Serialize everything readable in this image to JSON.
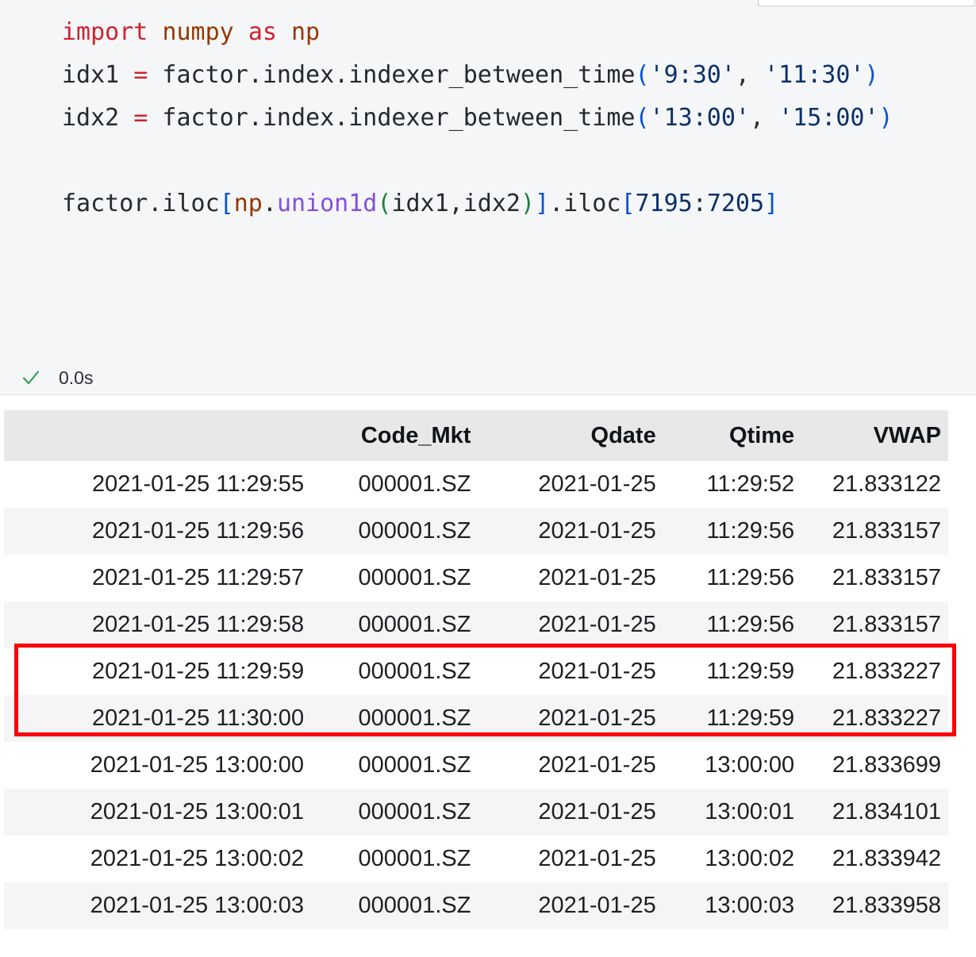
{
  "notebook": {
    "cell": {
      "language": "python",
      "code_lines": [
        [
          {
            "t": "import",
            "c": "kw"
          },
          {
            "t": " ",
            "c": "plain"
          },
          {
            "t": "numpy",
            "c": "module"
          },
          {
            "t": " ",
            "c": "plain"
          },
          {
            "t": "as",
            "c": "kw"
          },
          {
            "t": " ",
            "c": "plain"
          },
          {
            "t": "np",
            "c": "module"
          }
        ],
        [
          {
            "t": "idx1 ",
            "c": "plain"
          },
          {
            "t": "=",
            "c": "op"
          },
          {
            "t": " factor.index.indexer_between_time",
            "c": "plain"
          },
          {
            "t": "(",
            "c": "brkblue"
          },
          {
            "t": "'9:30'",
            "c": "str"
          },
          {
            "t": ",",
            "c": "punc"
          },
          {
            "t": " ",
            "c": "plain"
          },
          {
            "t": "'11:30'",
            "c": "str"
          },
          {
            "t": ")",
            "c": "brkblue"
          }
        ],
        [
          {
            "t": "idx2 ",
            "c": "plain"
          },
          {
            "t": "=",
            "c": "op"
          },
          {
            "t": " factor.index.indexer_between_time",
            "c": "plain"
          },
          {
            "t": "(",
            "c": "brkblue"
          },
          {
            "t": "'13:00'",
            "c": "str"
          },
          {
            "t": ",",
            "c": "punc"
          },
          {
            "t": " ",
            "c": "plain"
          },
          {
            "t": "'15:00'",
            "c": "str"
          },
          {
            "t": ")",
            "c": "brkblue"
          }
        ],
        [],
        [
          {
            "t": "factor.iloc",
            "c": "plain"
          },
          {
            "t": "[",
            "c": "brkblue"
          },
          {
            "t": "np",
            "c": "module"
          },
          {
            "t": ".",
            "c": "punc"
          },
          {
            "t": "union1d",
            "c": "func"
          },
          {
            "t": "(",
            "c": "paren"
          },
          {
            "t": "idx1,idx2",
            "c": "plain"
          },
          {
            "t": ")",
            "c": "paren"
          },
          {
            "t": "]",
            "c": "brkblue"
          },
          {
            "t": ".iloc",
            "c": "plain"
          },
          {
            "t": "[",
            "c": "brkblue"
          },
          {
            "t": "7195",
            "c": "num"
          },
          {
            "t": ":",
            "c": "punc"
          },
          {
            "t": "7205",
            "c": "num"
          },
          {
            "t": "]",
            "c": "brkblue"
          }
        ]
      ],
      "code_plain_text": "import numpy as np\nidx1 = factor.index.indexer_between_time('9:30', '11:30')\nidx2 = factor.index.indexer_between_time('13:00', '15:00')\n\nfactor.iloc[np.union1d(idx1,idx2)].iloc[7195:7205]",
      "status": {
        "icon": "check-icon",
        "state": "succeeded",
        "elapsed": "0.0s"
      }
    },
    "output": {
      "type": "dataframe",
      "columns": [
        "",
        "Code_Mkt",
        "Qdate",
        "Qtime",
        "VWAP"
      ],
      "rows": [
        {
          "index": "2021-01-25 11:29:55",
          "Code_Mkt": "000001.SZ",
          "Qdate": "2021-01-25",
          "Qtime": "11:29:52",
          "VWAP": "21.833122"
        },
        {
          "index": "2021-01-25 11:29:56",
          "Code_Mkt": "000001.SZ",
          "Qdate": "2021-01-25",
          "Qtime": "11:29:56",
          "VWAP": "21.833157"
        },
        {
          "index": "2021-01-25 11:29:57",
          "Code_Mkt": "000001.SZ",
          "Qdate": "2021-01-25",
          "Qtime": "11:29:56",
          "VWAP": "21.833157"
        },
        {
          "index": "2021-01-25 11:29:58",
          "Code_Mkt": "000001.SZ",
          "Qdate": "2021-01-25",
          "Qtime": "11:29:56",
          "VWAP": "21.833157"
        },
        {
          "index": "2021-01-25 11:29:59",
          "Code_Mkt": "000001.SZ",
          "Qdate": "2021-01-25",
          "Qtime": "11:29:59",
          "VWAP": "21.833227"
        },
        {
          "index": "2021-01-25 11:30:00",
          "Code_Mkt": "000001.SZ",
          "Qdate": "2021-01-25",
          "Qtime": "11:29:59",
          "VWAP": "21.833227"
        },
        {
          "index": "2021-01-25 13:00:00",
          "Code_Mkt": "000001.SZ",
          "Qdate": "2021-01-25",
          "Qtime": "13:00:00",
          "VWAP": "21.833699"
        },
        {
          "index": "2021-01-25 13:00:01",
          "Code_Mkt": "000001.SZ",
          "Qdate": "2021-01-25",
          "Qtime": "13:00:01",
          "VWAP": "21.834101"
        },
        {
          "index": "2021-01-25 13:00:02",
          "Code_Mkt": "000001.SZ",
          "Qdate": "2021-01-25",
          "Qtime": "13:00:02",
          "VWAP": "21.833942"
        },
        {
          "index": "2021-01-25 13:00:03",
          "Code_Mkt": "000001.SZ",
          "Qdate": "2021-01-25",
          "Qtime": "13:00:03",
          "VWAP": "21.833958"
        }
      ],
      "annotation": {
        "type": "rectangle-highlight",
        "color": "#fb0007",
        "covers_row_indices": [
          4,
          5
        ]
      }
    }
  },
  "colors": {
    "code_background": "#f5f6f8",
    "table_header_background": "#e8e8e8",
    "table_stripe_background": "#f5f5f5",
    "keyword": "#cf222e",
    "module": "#953800",
    "string": "#0a3069",
    "bracket_blue": "#0550d8",
    "function": "#8250df",
    "paren_green": "#1a7f37",
    "status_check": "#2e9e4f",
    "highlight_red": "#fb0007"
  }
}
